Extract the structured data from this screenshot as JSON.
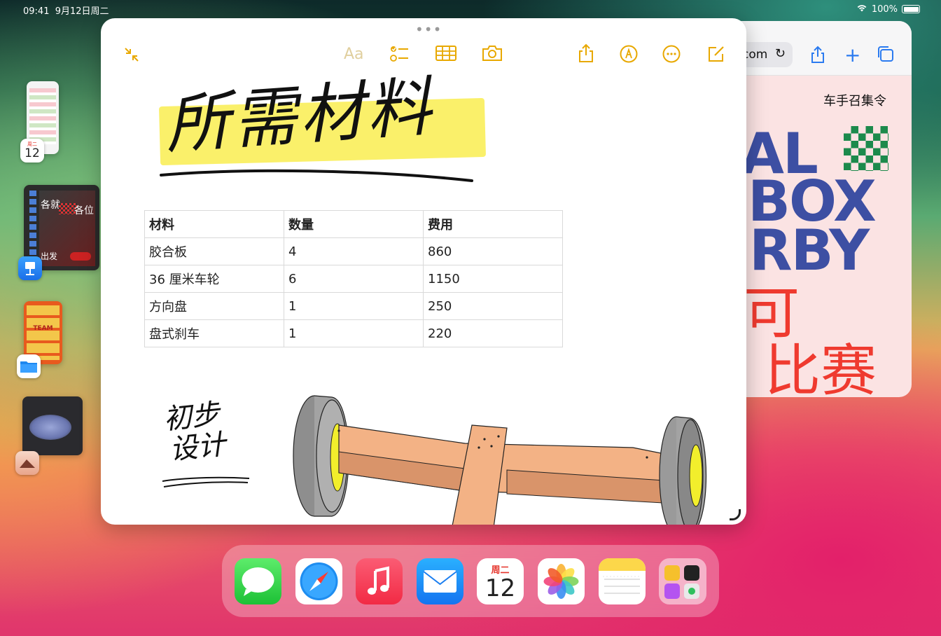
{
  "status_bar": {
    "time": "09:41",
    "date": "9月12日周二",
    "battery": "100%"
  },
  "notes": {
    "handwritten_title": "所需材料",
    "handwritten_caption_line1": "初步",
    "handwritten_caption_line2": "设计",
    "table": {
      "headers": [
        "材料",
        "数量",
        "费用"
      ],
      "rows": [
        [
          "胶合板",
          "4",
          "860"
        ],
        [
          "36 厘米车轮",
          "6",
          "1150"
        ],
        [
          "方向盘",
          "1",
          "250"
        ],
        [
          "盘式刹车",
          "1",
          "220"
        ]
      ]
    },
    "toolbar": {
      "collapse_icon": "collapse-arrows-icon",
      "format_label": "Aa",
      "checklist_icon": "checklist-icon",
      "table_icon": "table-icon",
      "camera_icon": "camera-icon",
      "share_icon": "share-icon",
      "markup_icon": "markup-pen-icon",
      "more_icon": "ellipsis-circle-icon",
      "compose_icon": "compose-icon"
    },
    "accent_color": "#e8a800"
  },
  "safari": {
    "url_fragment": "com",
    "poster_heading": "车手召集令",
    "poster_lines": [
      "AL",
      "BOX",
      "RBY"
    ],
    "poster_red_1": "可",
    "poster_red_2": "比赛",
    "accent_color": "#2b7bf0"
  },
  "stage_manager": {
    "calendar_badge_dow": "周二",
    "calendar_badge_day": "12",
    "keynote_slide_text_1": "各就",
    "keynote_slide_text_2": "各位",
    "keynote_slide_text_3": "出发",
    "pages_poster_text": "TEAM"
  },
  "dock": {
    "apps": [
      "Messages",
      "Safari",
      "Music",
      "Mail",
      "Calendar",
      "Photos",
      "Notes",
      "App Library"
    ],
    "calendar_dow": "周二",
    "calendar_day": "12"
  }
}
